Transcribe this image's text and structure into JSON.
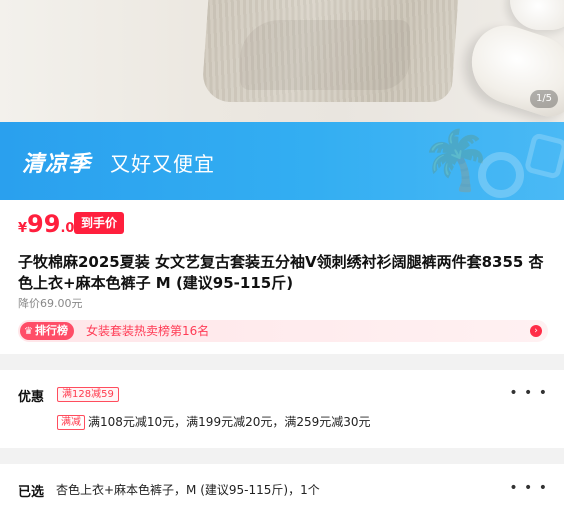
{
  "hero": {
    "pager": "1/5"
  },
  "banner": {
    "title": "清凉季",
    "subtitle": "又好又便宜"
  },
  "product": {
    "price_symbol": "¥",
    "price_int": "99",
    "price_dec": ".00",
    "price_tag": "到手价",
    "title": "子牧棉麻2025夏装 女文艺复古套装五分袖V领刺绣衬衫阔腿裤两件套8355 杏色上衣+麻本色裤子 M (建议95-115斤)",
    "old_price": "降价69.00元",
    "rank_badge": "排行榜",
    "rank_text": "女装套装热卖榜第16名"
  },
  "promotions": {
    "label": "优惠",
    "coupon": "满128减59",
    "tag": "满减",
    "rules": "满108元减10元，满199元减20元，满259元减30元"
  },
  "selected": {
    "label": "已选",
    "value": "杏色上衣+麻本色裤子，M (建议95-115斤)，1个"
  },
  "colors": {
    "accent_red": "#ff1f3d",
    "banner_blue": "#33aef2"
  }
}
